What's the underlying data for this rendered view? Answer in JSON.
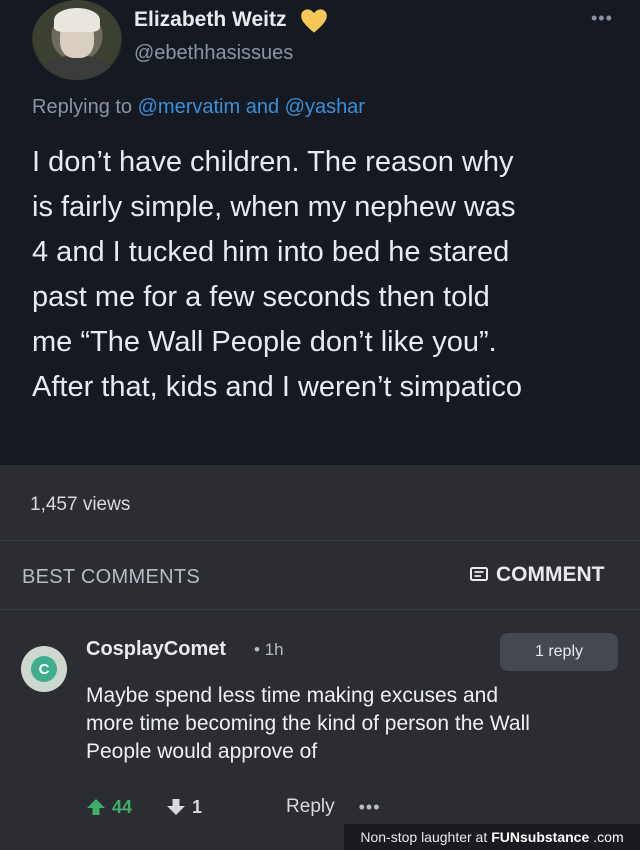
{
  "tweet": {
    "author_name": "Elizabeth Weitz",
    "author_badge_icon": "yellow-heart-icon",
    "badge_color": "#f4c955",
    "handle": "@ebethhasissues",
    "more_icon": "more-dots-icon",
    "replying_prefix": "Replying to",
    "replying_mentions": "@mervatim and @yashar",
    "mention_color": "#3b8fd9",
    "text_lines": [
      "I don’t have children. The reason why",
      "is fairly simple, when my nephew was",
      "4 and I tucked him into bed he stared",
      "past me for a few seconds then told",
      "me “The Wall People don’t like you”.",
      "After that, kids and I weren’t simpatico"
    ]
  },
  "post": {
    "views": "1,457 views"
  },
  "comments_header": {
    "title": "BEST COMMENTS",
    "comment_button": "COMMENT",
    "comment_icon": "comment-icon"
  },
  "comment": {
    "avatar_letter": "C",
    "avatar_color": "#3fae8f",
    "username": "CosplayComet",
    "time": "• 1h",
    "reply_count": "1 reply",
    "text_lines": [
      "Maybe spend less time making excuses and",
      "more time becoming the kind of person the Wall",
      "People would approve of"
    ],
    "upvotes": "44",
    "upvote_color": "#3fae6a",
    "downvotes": "1",
    "reply_label": "Reply",
    "more_icon": "more-dots-icon"
  },
  "watermark": {
    "prefix": "Non-stop laughter at",
    "brand": "FUNsubstance",
    "tld": ".com"
  }
}
